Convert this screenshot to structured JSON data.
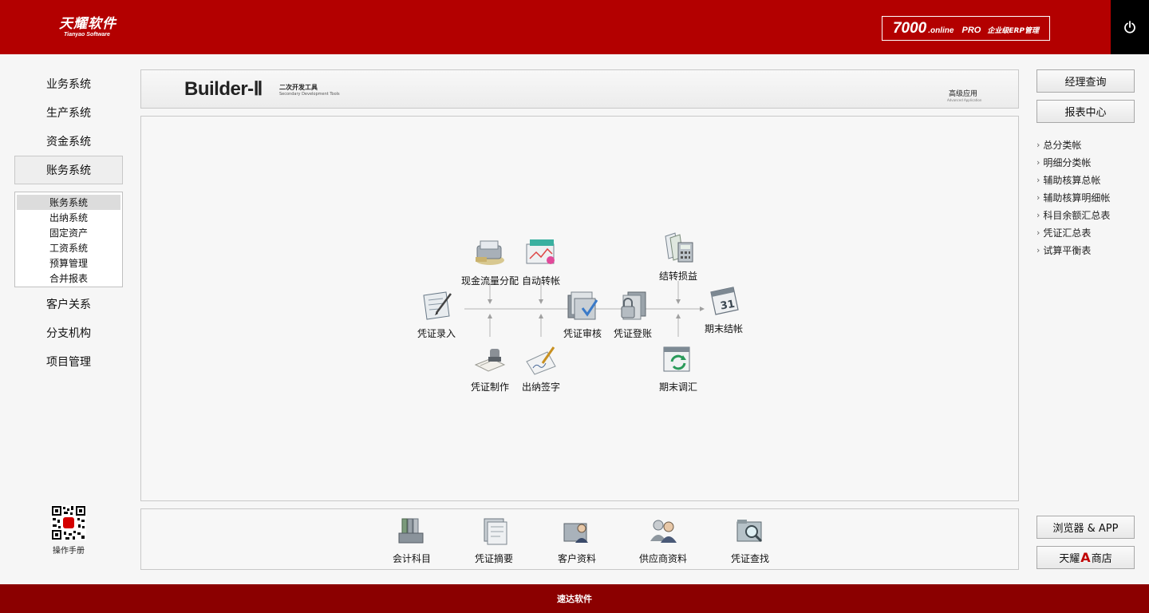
{
  "header": {
    "logo_cn": "天耀软件",
    "logo_en": "Tianyao Software",
    "product_number": "7000",
    "product_online": ".online",
    "product_pro": "PRO",
    "product_erp": "企业级ERP管理",
    "power_icon": "power-icon",
    "colors": {
      "header_bg": "#b30000",
      "power_bg": "#000000"
    }
  },
  "left_nav": {
    "top_items": [
      "业务系统",
      "生产系统",
      "资金系统",
      "账务系统"
    ],
    "active": "账务系统",
    "submenu": [
      "账务系统",
      "出纳系统",
      "固定资产",
      "工资系统",
      "预算管理",
      "合并报表"
    ],
    "submenu_selected": "账务系统",
    "bottom_items": [
      "客户关系",
      "分支机构",
      "项目管理"
    ],
    "manual_label": "操作手册",
    "manual_icon": "qr-code-icon"
  },
  "banner": {
    "title": "Builder-Ⅱ",
    "subtitle_cn": "二次开发工具",
    "subtitle_en": "Secondary Development Tools",
    "advanced_cn": "高级应用",
    "advanced_en": "Advanced Application"
  },
  "flow": {
    "nodes": {
      "voucher_entry": {
        "label": "凭证录入",
        "icon": "voucher-entry-icon"
      },
      "cash_flow": {
        "label": "现金流量分配",
        "icon": "cash-flow-icon"
      },
      "auto_transfer": {
        "label": "自动转帐",
        "icon": "auto-transfer-icon"
      },
      "voucher_make": {
        "label": "凭证制作",
        "icon": "voucher-stamp-icon"
      },
      "cashier_sign": {
        "label": "出纳签字",
        "icon": "sign-pen-icon"
      },
      "voucher_audit": {
        "label": "凭证审核",
        "icon": "folder-check-icon"
      },
      "voucher_post": {
        "label": "凭证登账",
        "icon": "lock-folder-icon"
      },
      "carry_forward": {
        "label": "结转损益",
        "icon": "ledger-calculator-icon"
      },
      "period_close": {
        "label": "期末结帐",
        "icon": "calendar-31-icon"
      },
      "period_exchange": {
        "label": "期末调汇",
        "icon": "calendar-refresh-icon"
      }
    }
  },
  "toolbar": {
    "items": [
      {
        "label": "会计科目",
        "icon": "binders-icon"
      },
      {
        "label": "凭证摘要",
        "icon": "documents-icon"
      },
      {
        "label": "客户资料",
        "icon": "customer-folder-icon"
      },
      {
        "label": "供应商资料",
        "icon": "supplier-people-icon"
      },
      {
        "label": "凭证查找",
        "icon": "folder-search-icon"
      }
    ]
  },
  "right": {
    "manager_query": "经理查询",
    "report_center": "报表中心",
    "links": [
      "总分类帐",
      "明细分类帐",
      "辅助核算总帐",
      "辅助核算明细帐",
      "科目余额汇总表",
      "凭证汇总表",
      "试算平衡表"
    ],
    "browser_app": "浏览器 & APP",
    "shop_pre": "天耀",
    "shop_a": "A",
    "shop_post": "商店"
  },
  "footer": {
    "text": "速达软件",
    "color": "#8b0000"
  }
}
